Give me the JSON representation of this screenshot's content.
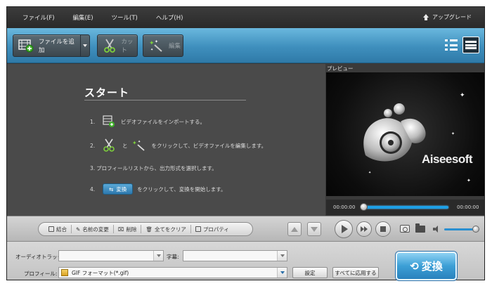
{
  "menu": {
    "items": [
      "ファイル(F)",
      "編集(E)",
      "ツール(T)",
      "ヘルプ(H)"
    ],
    "upgrade_label": "アップグレード"
  },
  "toolbar": {
    "add_file_label": "ファイルを追加",
    "cut_label": "カット",
    "edit_label": "編集",
    "icons": [
      "film-plus-icon",
      "scissors-icon",
      "magic-wand-icon",
      "list-view-icon",
      "detail-view-icon"
    ]
  },
  "start": {
    "title": "スタート",
    "steps": [
      {
        "num": "1.",
        "text": "ビデオファイルをインポートする。"
      },
      {
        "num": "2.",
        "mid": "と",
        "text": "をクリックして、ビデオファイルを編集します。"
      },
      {
        "num": "3.",
        "text": "プロフィールリストから、出力形式を選択します。"
      },
      {
        "num": "4.",
        "button": "変換",
        "text": "をクリックして、変換を開始します。"
      }
    ]
  },
  "preview": {
    "label": "プレビュー",
    "brand": "Aiseesoft",
    "time_current": "00:00:00",
    "time_total": "00:00:00",
    "progress": 0
  },
  "actions": {
    "merge": "結合",
    "rename": "名前の変更",
    "delete": "削除",
    "clear_all": "全てをクリア",
    "properties": "プロパティ"
  },
  "player": {
    "volume": 0.9
  },
  "bottom": {
    "audio_track_label": "オーディオトラック:",
    "audio_track_value": "",
    "subtitle_label": "字幕:",
    "subtitle_value": "",
    "profile_label": "プロフィール:",
    "profile_value": "GIF フォーマット(*.gif)",
    "settings_button": "設定",
    "apply_all_button": "すべてに応用する",
    "convert_button": "変換"
  },
  "colors": {
    "toolbar_blue": "#3f8fbd",
    "accent_blue": "#1ea0e6",
    "convert_blue": "#3c9fd6"
  }
}
